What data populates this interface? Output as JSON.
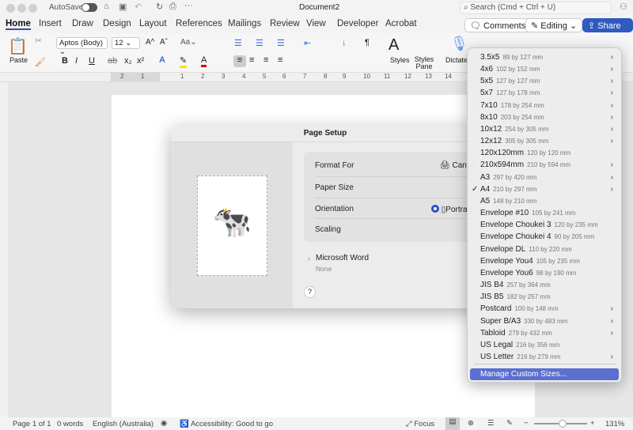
{
  "titlebar": {
    "autosave": "AutoSave",
    "doc_title": "Document2",
    "search_placeholder": "Search (Cmd + Ctrl + U)"
  },
  "tabs": [
    "Home",
    "Insert",
    "Draw",
    "Design",
    "Layout",
    "References",
    "Mailings",
    "Review",
    "View",
    "Developer",
    "Acrobat"
  ],
  "header_buttons": {
    "comments": "Comments",
    "editing": "Editing",
    "share": "Share"
  },
  "ribbon": {
    "paste": "Paste",
    "font": "Aptos (Body)",
    "size": "12",
    "styles": "Styles",
    "styles_pane": "Styles Pane",
    "dictate": "Dictate"
  },
  "ruler": [
    "2",
    "1",
    "1",
    "2",
    "3",
    "4",
    "5",
    "6",
    "7",
    "8",
    "9",
    "10",
    "11",
    "12",
    "13",
    "14"
  ],
  "dialog": {
    "title": "Page Setup",
    "format_for": "Format For",
    "format_value": "Canon",
    "paper_size": "Paper Size",
    "orientation": "Orientation",
    "orientation_value": "Portrait",
    "scaling": "Scaling",
    "section": "Microsoft Word",
    "section_sub": "None",
    "help": "?"
  },
  "menu": {
    "items": [
      {
        "name": "3.5x5",
        "size": "89 by 127 mm",
        "sub": true
      },
      {
        "name": "4x6",
        "size": "102 by 152 mm",
        "sub": true
      },
      {
        "name": "5x5",
        "size": "127 by 127 mm",
        "sub": true
      },
      {
        "name": "5x7",
        "size": "127 by 178 mm",
        "sub": true
      },
      {
        "name": "7x10",
        "size": "178 by 254 mm",
        "sub": true
      },
      {
        "name": "8x10",
        "size": "203 by 254 mm",
        "sub": true
      },
      {
        "name": "10x12",
        "size": "254 by 305 mm",
        "sub": true
      },
      {
        "name": "12x12",
        "size": "305 by 305 mm",
        "sub": true
      },
      {
        "name": "120x120mm",
        "size": "120 by 120 mm",
        "sub": false
      },
      {
        "name": "210x594mm",
        "size": "210 by 594 mm",
        "sub": true
      },
      {
        "name": "A3",
        "size": "297 by 420 mm",
        "sub": true
      },
      {
        "name": "A4",
        "size": "210 by 297 mm",
        "sub": true,
        "checked": true
      },
      {
        "name": "A5",
        "size": "148 by 210 mm",
        "sub": false
      },
      {
        "name": "Envelope #10",
        "size": "105 by 241 mm",
        "sub": false
      },
      {
        "name": "Envelope Choukei 3",
        "size": "120 by 235 mm",
        "sub": false
      },
      {
        "name": "Envelope Choukei 4",
        "size": "90 by 205 mm",
        "sub": false
      },
      {
        "name": "Envelope DL",
        "size": "110 by 220 mm",
        "sub": false
      },
      {
        "name": "Envelope You4",
        "size": "105 by 235 mm",
        "sub": false
      },
      {
        "name": "Envelope You6",
        "size": "98 by 190 mm",
        "sub": false
      },
      {
        "name": "JIS B4",
        "size": "257 by 364 mm",
        "sub": false
      },
      {
        "name": "JIS B5",
        "size": "182 by 257 mm",
        "sub": false
      },
      {
        "name": "Postcard",
        "size": "100 by 148 mm",
        "sub": true
      },
      {
        "name": "Super B/A3",
        "size": "330 by 483 mm",
        "sub": true
      },
      {
        "name": "Tabloid",
        "size": "279 by 432 mm",
        "sub": true
      },
      {
        "name": "US Legal",
        "size": "216 by 356 mm",
        "sub": false
      },
      {
        "name": "US Letter",
        "size": "216 by 279 mm",
        "sub": true
      }
    ],
    "manage": "Manage Custom Sizes..."
  },
  "status": {
    "page": "Page 1 of 1",
    "words": "0 words",
    "language": "English (Australia)",
    "accessibility": "Accessibility: Good to go",
    "focus": "Focus",
    "zoom": "131%"
  },
  "colors": {
    "accent": "#2f5bbf",
    "highlight": "#5b6fd0"
  }
}
